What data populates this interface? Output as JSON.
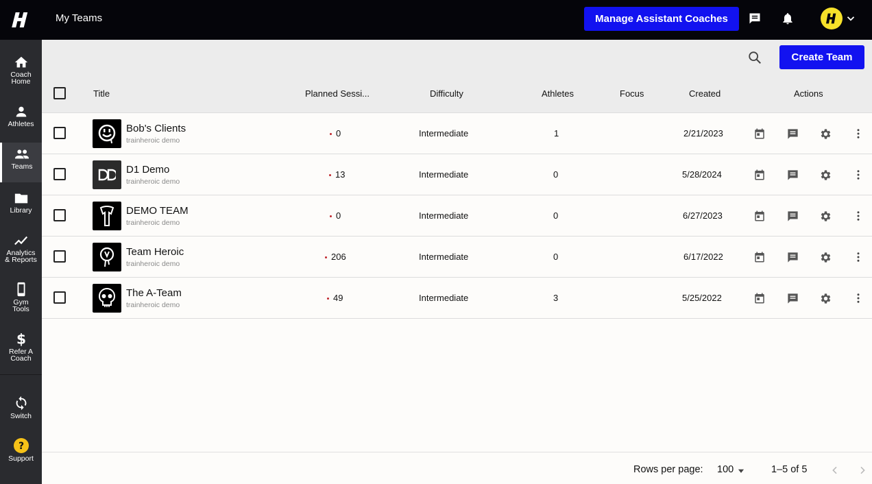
{
  "header": {
    "title": "My Teams",
    "manage_label": "Manage Assistant Coaches",
    "logo_letter": "H",
    "avatar_letter": "H"
  },
  "sidebar": {
    "items": [
      {
        "label_1": "Coach",
        "label_2": "Home",
        "icon": "home-icon"
      },
      {
        "label_1": "Athletes",
        "label_2": "",
        "icon": "person-icon"
      },
      {
        "label_1": "Teams",
        "label_2": "",
        "icon": "group-icon"
      },
      {
        "label_1": "Library",
        "label_2": "",
        "icon": "folder-icon"
      },
      {
        "label_1": "Analytics",
        "label_2": "& Reports",
        "icon": "chart-icon"
      },
      {
        "label_1": "Gym",
        "label_2": "Tools",
        "icon": "phone-icon"
      },
      {
        "label_1": "Refer A",
        "label_2": "Coach",
        "icon": "dollar-icon"
      },
      {
        "label_1": "Switch",
        "label_2": "",
        "icon": "switch-icon"
      },
      {
        "label_1": "Support",
        "label_2": "",
        "icon": "help-icon"
      }
    ]
  },
  "toolbar": {
    "create_label": "Create Team"
  },
  "table": {
    "columns": [
      "Title",
      "Planned Sessi...",
      "Difficulty",
      "Athletes",
      "Focus",
      "Created",
      "Actions"
    ],
    "rows": [
      {
        "name": "Bob's Clients",
        "sub": "trainheroic demo",
        "sessions": "0",
        "difficulty": "Intermediate",
        "athletes": "1",
        "focus": "",
        "created": "2/21/2023"
      },
      {
        "name": "D1 Demo",
        "sub": "trainheroic demo",
        "sessions": "13",
        "difficulty": "Intermediate",
        "athletes": "0",
        "focus": "",
        "created": "5/28/2024"
      },
      {
        "name": "DEMO TEAM",
        "sub": "trainheroic demo",
        "sessions": "0",
        "difficulty": "Intermediate",
        "athletes": "0",
        "focus": "",
        "created": "6/27/2023"
      },
      {
        "name": "Team Heroic",
        "sub": "trainheroic demo",
        "sessions": "206",
        "difficulty": "Intermediate",
        "athletes": "0",
        "focus": "",
        "created": "6/17/2022"
      },
      {
        "name": "The A-Team",
        "sub": "trainheroic demo",
        "sessions": "49",
        "difficulty": "Intermediate",
        "athletes": "3",
        "focus": "",
        "created": "5/25/2022"
      }
    ]
  },
  "footer": {
    "rows_per_page_label": "Rows per page:",
    "rows_per_page_value": "100",
    "range": "1–5 of 5"
  },
  "colors": {
    "accent": "#1212f0",
    "topbar": "#05050a",
    "sidebar": "#2a2b2f",
    "avatar": "#f6e12a"
  }
}
